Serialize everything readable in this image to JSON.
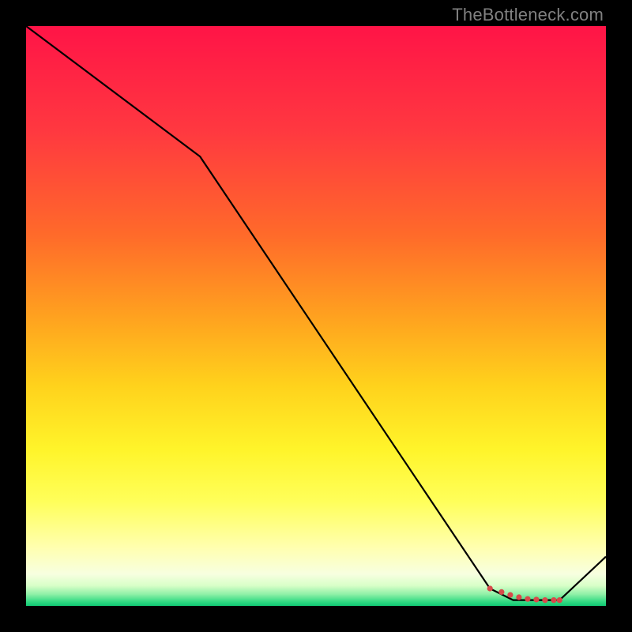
{
  "watermark": "TheBottleneck.com",
  "chart_data": {
    "type": "line",
    "title": "",
    "xlabel": "",
    "ylabel": "",
    "xlim": [
      0,
      100
    ],
    "ylim": [
      0,
      100
    ],
    "x": [
      0,
      10,
      30,
      80,
      84,
      90,
      92,
      100
    ],
    "values": [
      100,
      92.5,
      77.5,
      3.0,
      1.0,
      1.0,
      1.0,
      8.5
    ],
    "gradient_stops": [
      {
        "t": 0.0,
        "color": "#ff1447"
      },
      {
        "t": 0.18,
        "color": "#ff3840"
      },
      {
        "t": 0.36,
        "color": "#ff6a2a"
      },
      {
        "t": 0.5,
        "color": "#ffa11f"
      },
      {
        "t": 0.62,
        "color": "#ffd21c"
      },
      {
        "t": 0.73,
        "color": "#fff42a"
      },
      {
        "t": 0.82,
        "color": "#ffff5a"
      },
      {
        "t": 0.9,
        "color": "#ffffb0"
      },
      {
        "t": 0.945,
        "color": "#f7ffe0"
      },
      {
        "t": 0.965,
        "color": "#d8ffc8"
      },
      {
        "t": 0.98,
        "color": "#8ef0a6"
      },
      {
        "t": 0.993,
        "color": "#30d982"
      },
      {
        "t": 1.0,
        "color": "#10c873"
      }
    ],
    "line_color": "#000000",
    "marker_color": "#d84a4a",
    "markers_x": [
      80,
      82,
      83.5,
      85,
      86.5,
      88,
      89.5,
      91,
      92
    ],
    "markers_y": [
      3.0,
      2.4,
      1.9,
      1.5,
      1.2,
      1.1,
      1.0,
      1.0,
      1.0
    ]
  }
}
